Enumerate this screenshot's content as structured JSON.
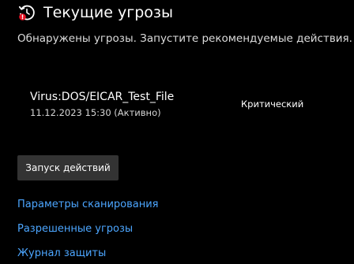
{
  "header": {
    "icon": "threat-history-icon",
    "title": "Текущие угрозы"
  },
  "description": "Обнаружены угрозы. Запустите рекомендуемые действия.",
  "threats": [
    {
      "name": "Virus:DOS/EICAR_Test_File",
      "date": "11.12.2023 15:30 (Активно)",
      "severity": "Критический"
    }
  ],
  "actions": {
    "start_label": "Запуск действий"
  },
  "links": {
    "scan_options": "Параметры сканирования",
    "allowed_threats": "Разрешенные угрозы",
    "protection_history": "Журнал защиты"
  },
  "colors": {
    "background": "#000000",
    "link": "#4ca6ff",
    "alert": "#e81123",
    "button": "#333333"
  }
}
